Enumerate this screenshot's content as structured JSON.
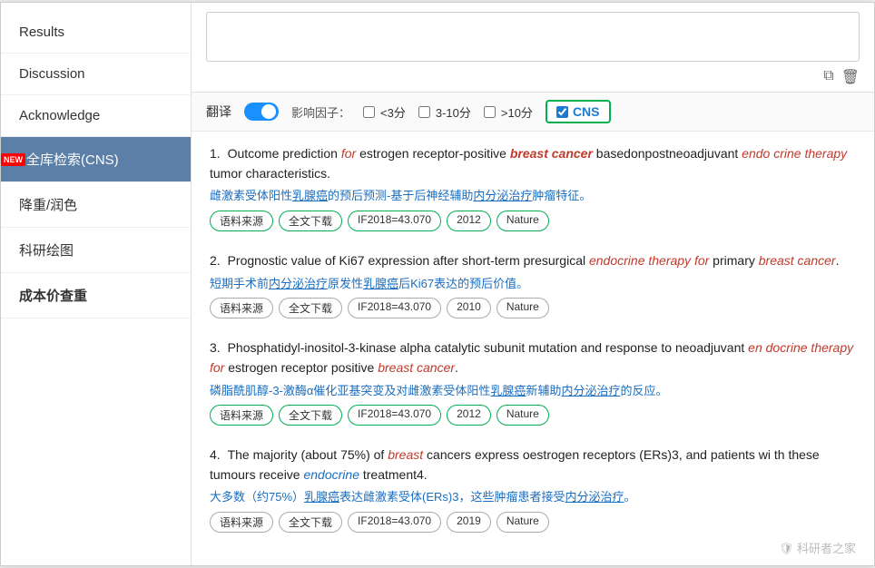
{
  "sidebar": {
    "items": [
      {
        "label": "Results",
        "active": false,
        "bold": false,
        "new": false
      },
      {
        "label": "Discussion",
        "active": false,
        "bold": false,
        "new": false
      },
      {
        "label": "Acknowledge",
        "active": false,
        "bold": false,
        "new": false
      },
      {
        "label": "全库检索(CNS)",
        "active": true,
        "bold": false,
        "new": true
      },
      {
        "label": "降重/润色",
        "active": false,
        "bold": false,
        "new": false
      },
      {
        "label": "科研绘图",
        "active": false,
        "bold": false,
        "new": false
      },
      {
        "label": "成本价查重",
        "active": false,
        "bold": true,
        "new": false
      }
    ]
  },
  "filter": {
    "translate_label": "翻译",
    "if_label": "影响因子：",
    "opt1": "<3分",
    "opt2": "3-10分",
    "opt3": ">10分",
    "cns_label": "CNS"
  },
  "results": [
    {
      "number": "1.",
      "title_parts": [
        {
          "text": "Outcome prediction ",
          "style": "normal"
        },
        {
          "text": "for",
          "style": "italic-red"
        },
        {
          "text": " estrogen receptor-positive ",
          "style": "normal"
        },
        {
          "text": "breast cancer",
          "style": "bold-red"
        },
        {
          "text": " basedonpostneoadjuvant ",
          "style": "normal"
        },
        {
          "text": "endo crine therapy",
          "style": "italic-red"
        },
        {
          "text": " tumor characteristics.",
          "style": "normal"
        }
      ],
      "cn_title": "雌激素受体阳性乳腺癌的预后预测-基于后神经辅助内分泌治疗肿瘤特征。",
      "cn_underline_parts": [
        {
          "text": "雌激素受体阳性",
          "ul": false
        },
        {
          "text": "乳腺癌",
          "ul": true
        },
        {
          "text": "的预后预测-基于后神经辅助",
          "ul": false
        },
        {
          "text": "内分泌治疗",
          "ul": true
        },
        {
          "text": "肿瘤特征。",
          "ul": false
        }
      ],
      "tags": [
        "语料来源",
        "全文下载",
        "IF2018=43.070",
        "2012",
        "Nature"
      ],
      "tags_green": true
    },
    {
      "number": "2.",
      "title_parts": [
        {
          "text": "Prognostic value of Ki67 expression after short-term presurgical ",
          "style": "normal"
        },
        {
          "text": "endocrine therapy for",
          "style": "italic-red"
        },
        {
          "text": " primary ",
          "style": "normal"
        },
        {
          "text": "breast cancer",
          "style": "italic-red"
        },
        {
          "text": ".",
          "style": "normal"
        }
      ],
      "cn_title": "短期手术前内分泌治疗原发性乳腺癌后Ki67表达的预后价值。",
      "cn_underline_parts": [
        {
          "text": "短期手术前",
          "ul": false
        },
        {
          "text": "内分泌治疗",
          "ul": true
        },
        {
          "text": "原发性",
          "ul": false
        },
        {
          "text": "乳腺癌",
          "ul": true
        },
        {
          "text": "后Ki67表达的预后价值。",
          "ul": false
        }
      ],
      "tags": [
        "语料来源",
        "全文下载",
        "IF2018=43.070",
        "2010",
        "Nature"
      ],
      "tags_green": false
    },
    {
      "number": "3.",
      "title_parts": [
        {
          "text": "Phosphatidyl-inositol-3-kinase alpha catalytic subunit mutation and response to neoadjuvant ",
          "style": "normal"
        },
        {
          "text": "en docrine therapy for",
          "style": "italic-red"
        },
        {
          "text": " estrogen receptor positive ",
          "style": "normal"
        },
        {
          "text": "breast cancer",
          "style": "italic-red"
        },
        {
          "text": ".",
          "style": "normal"
        }
      ],
      "cn_title": "磷脂酰肌醇-3-激酶α催化亚基突变及对雌激素受体阳性乳腺癌新辅助内分泌治疗的反应。",
      "cn_underline_parts": [
        {
          "text": "磷脂酰肌醇-3-激酶α催化亚基突变及对雌激素受体阳性",
          "ul": false
        },
        {
          "text": "乳腺癌",
          "ul": true
        },
        {
          "text": "新辅助",
          "ul": false
        },
        {
          "text": "内分泌治疗",
          "ul": true
        },
        {
          "text": "的反应。",
          "ul": false
        }
      ],
      "tags": [
        "语料来源",
        "全文下载",
        "IF2018=43.070",
        "2012",
        "Nature"
      ],
      "tags_green": true
    },
    {
      "number": "4.",
      "title_parts": [
        {
          "text": "The majority (about 75%) of ",
          "style": "normal"
        },
        {
          "text": "breast",
          "style": "italic-red"
        },
        {
          "text": " cancers express oestrogen receptors (ERs)3, and patients wi th these tumours receive ",
          "style": "normal"
        },
        {
          "text": "endocrine",
          "style": "italic-blue"
        },
        {
          "text": " treatment4.",
          "style": "normal"
        }
      ],
      "cn_title": "大多数（约75%）乳腺癌表达雌激素受体(ERs)3，这些肿瘤患者接受内分泌治疗。",
      "cn_underline_parts": [
        {
          "text": "大多数（约75%）",
          "ul": false
        },
        {
          "text": "乳腺癌",
          "ul": true
        },
        {
          "text": "表达雌激素受体(ERs)3，这些肿瘤患者接受",
          "ul": false
        },
        {
          "text": "内分泌治疗",
          "ul": true
        },
        {
          "text": "。",
          "ul": false
        }
      ],
      "tags": [
        "语料来源",
        "全文下载",
        "IF2018=43.070",
        "2019",
        "Nature"
      ],
      "tags_green": false
    }
  ],
  "watermark": "🛡 科研者之家"
}
